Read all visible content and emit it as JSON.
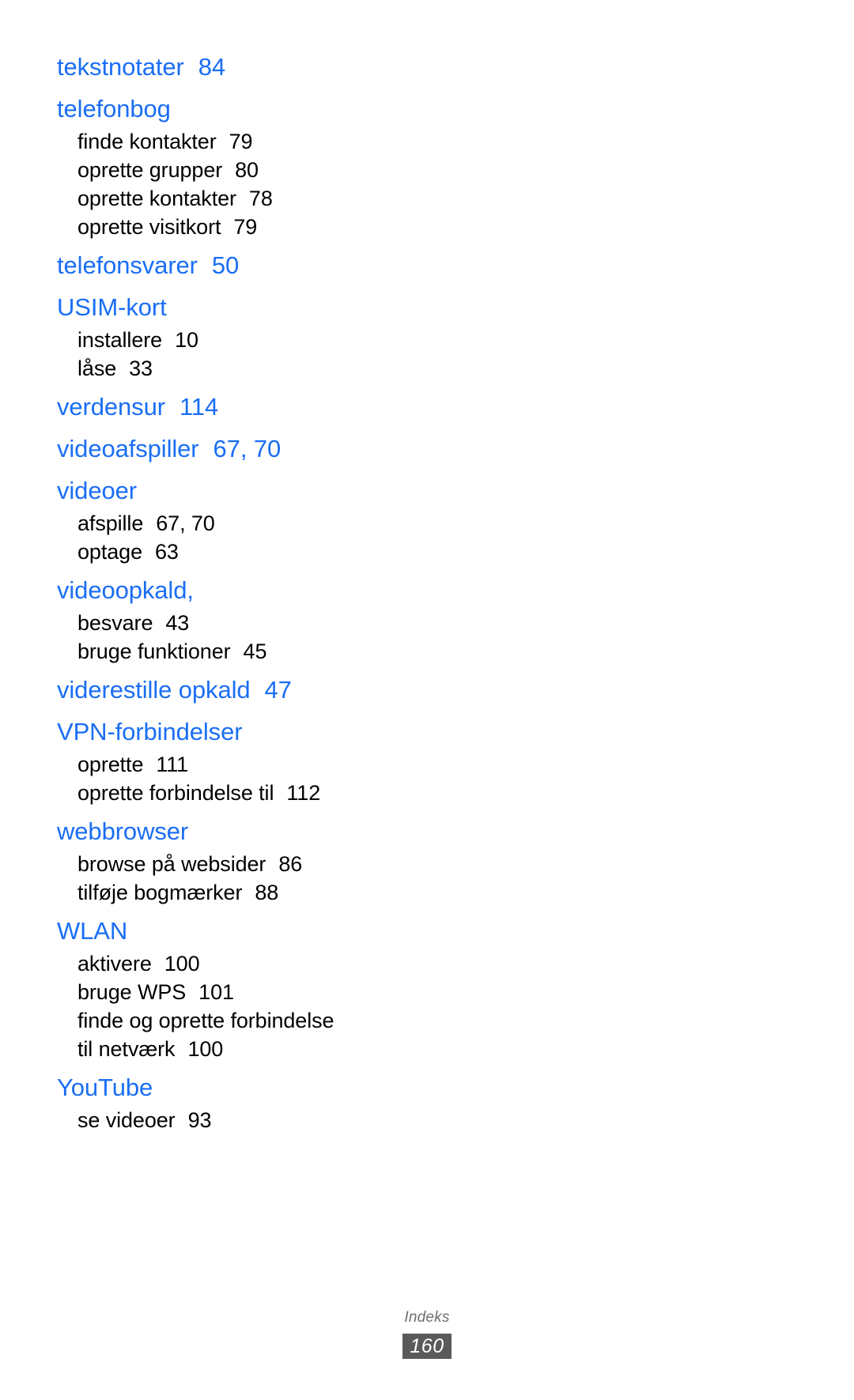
{
  "document": {
    "type": "index",
    "language": "da"
  },
  "index": {
    "groups": [
      {
        "heading": "tekstnotater",
        "heading_pages": "84",
        "entries": []
      },
      {
        "heading": "telefonbog",
        "heading_pages": "",
        "entries": [
          {
            "label": "finde kontakter",
            "pages": "79"
          },
          {
            "label": "oprette grupper",
            "pages": "80"
          },
          {
            "label": "oprette kontakter",
            "pages": "78"
          },
          {
            "label": "oprette visitkort",
            "pages": "79"
          }
        ]
      },
      {
        "heading": "telefonsvarer",
        "heading_pages": "50",
        "entries": []
      },
      {
        "heading": "USIM-kort",
        "heading_pages": "",
        "entries": [
          {
            "label": "installere",
            "pages": "10"
          },
          {
            "label": "låse",
            "pages": "33"
          }
        ]
      },
      {
        "heading": "verdensur",
        "heading_pages": "114",
        "entries": []
      },
      {
        "heading": "videoafspiller",
        "heading_pages": "67, 70",
        "entries": []
      },
      {
        "heading": "videoer",
        "heading_pages": "",
        "entries": [
          {
            "label": "afspille",
            "pages": "67, 70"
          },
          {
            "label": "optage",
            "pages": "63"
          }
        ]
      },
      {
        "heading": "videoopkald,",
        "heading_pages": "",
        "entries": [
          {
            "label": "besvare",
            "pages": "43"
          },
          {
            "label": "bruge funktioner",
            "pages": "45"
          }
        ]
      },
      {
        "heading": "viderestille opkald",
        "heading_pages": "47",
        "entries": []
      },
      {
        "heading": "VPN-forbindelser",
        "heading_pages": "",
        "entries": [
          {
            "label": "oprette",
            "pages": "111"
          },
          {
            "label": "oprette forbindelse til",
            "pages": "112"
          }
        ]
      },
      {
        "heading": "webbrowser",
        "heading_pages": "",
        "entries": [
          {
            "label": "browse på websider",
            "pages": "86"
          },
          {
            "label": "tilføje bogmærker",
            "pages": "88"
          }
        ]
      },
      {
        "heading": "WLAN",
        "heading_pages": "",
        "entries": [
          {
            "label": "aktivere",
            "pages": "100"
          },
          {
            "label": "bruge WPS",
            "pages": "101"
          },
          {
            "label": "finde og oprette forbindelse\ntil netværk",
            "pages": "100",
            "wrapped": true
          }
        ]
      },
      {
        "heading": "YouTube",
        "heading_pages": "",
        "entries": [
          {
            "label": "se videoer",
            "pages": "93"
          }
        ]
      }
    ]
  },
  "footer": {
    "label": "Indeks",
    "page_number": "160"
  },
  "colors": {
    "heading": "#1a6ef5",
    "entry_text": "#000000",
    "footer_label": "#6e6e6e",
    "footer_box_bg": "#5a5a5a",
    "footer_box_text": "#ffffff",
    "page_background": "#ffffff"
  }
}
